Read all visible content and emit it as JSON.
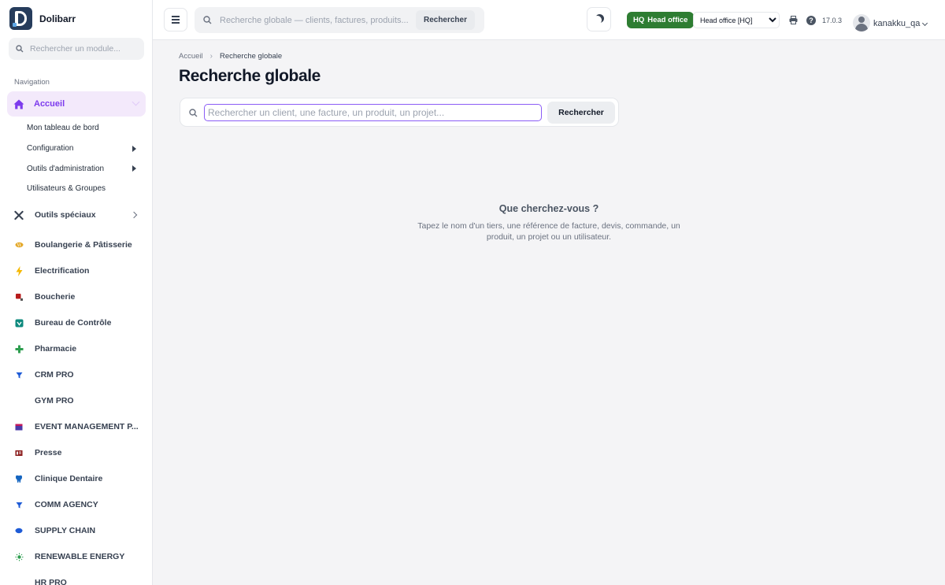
{
  "brand": {
    "name": "Dolibarr"
  },
  "sidebar": {
    "module_search_placeholder": "Rechercher un module...",
    "nav_heading": "Navigation",
    "active": {
      "label": "Accueil",
      "icon": "home-icon"
    },
    "submenu": [
      {
        "label": "Mon tableau de bord"
      },
      {
        "label": "Configuration"
      },
      {
        "label": "Outils d'administration"
      },
      {
        "label": "Utilisateurs & Groupes"
      }
    ],
    "items": [
      {
        "label": "Outils spéciaux",
        "icon": "tools-icon"
      },
      {
        "label": "Boulangerie & Pâtisserie",
        "icon": "bread-icon"
      },
      {
        "label": "Electrification",
        "icon": "lightning-icon"
      },
      {
        "label": "Boucherie",
        "icon": "meat-icon"
      },
      {
        "label": "Bureau de Contrôle",
        "icon": "shield-icon"
      },
      {
        "label": "Pharmacie",
        "icon": "cross-icon"
      },
      {
        "label": "CRM PRO",
        "icon": "filter-icon"
      },
      {
        "label": "GYM PRO",
        "icon": "none"
      },
      {
        "label": "EVENT MANAGEMENT P...",
        "icon": "calendar-icon"
      },
      {
        "label": "Presse",
        "icon": "newspaper-icon"
      },
      {
        "label": "Clinique Dentaire",
        "icon": "tooth-icon"
      },
      {
        "label": "COMM AGENCY",
        "icon": "filter-icon"
      },
      {
        "label": "SUPPLY CHAIN",
        "icon": "box-icon"
      },
      {
        "label": "RENEWABLE ENERGY",
        "icon": "sun-icon"
      },
      {
        "label": "HR PRO",
        "icon": "none"
      }
    ]
  },
  "topbar": {
    "search_placeholder": "Recherche globale — clients, factures, produits...",
    "search_button": "Rechercher",
    "entity_badge": {
      "code": "HQ",
      "name": "Head office"
    },
    "entity_select": "Head office [HQ]",
    "version": "17.0.3",
    "username": "kanakku_qa"
  },
  "main": {
    "breadcrumb": {
      "home": "Accueil",
      "current": "Recherche globale"
    },
    "title": "Recherche globale",
    "search_placeholder": "Rechercher un client, une facture, un produit, un projet...",
    "search_button": "Rechercher",
    "empty_title": "Que cherchez-vous ?",
    "empty_desc": "Tapez le nom d'un tiers, une référence de facture, devis, commande, un produit, un projet ou un utilisateur."
  },
  "colors": {
    "accent": "#7c3aed",
    "active_bg": "#f3e9fb",
    "badge_green": "#2e7d32",
    "brand_dark": "#263c5c"
  }
}
